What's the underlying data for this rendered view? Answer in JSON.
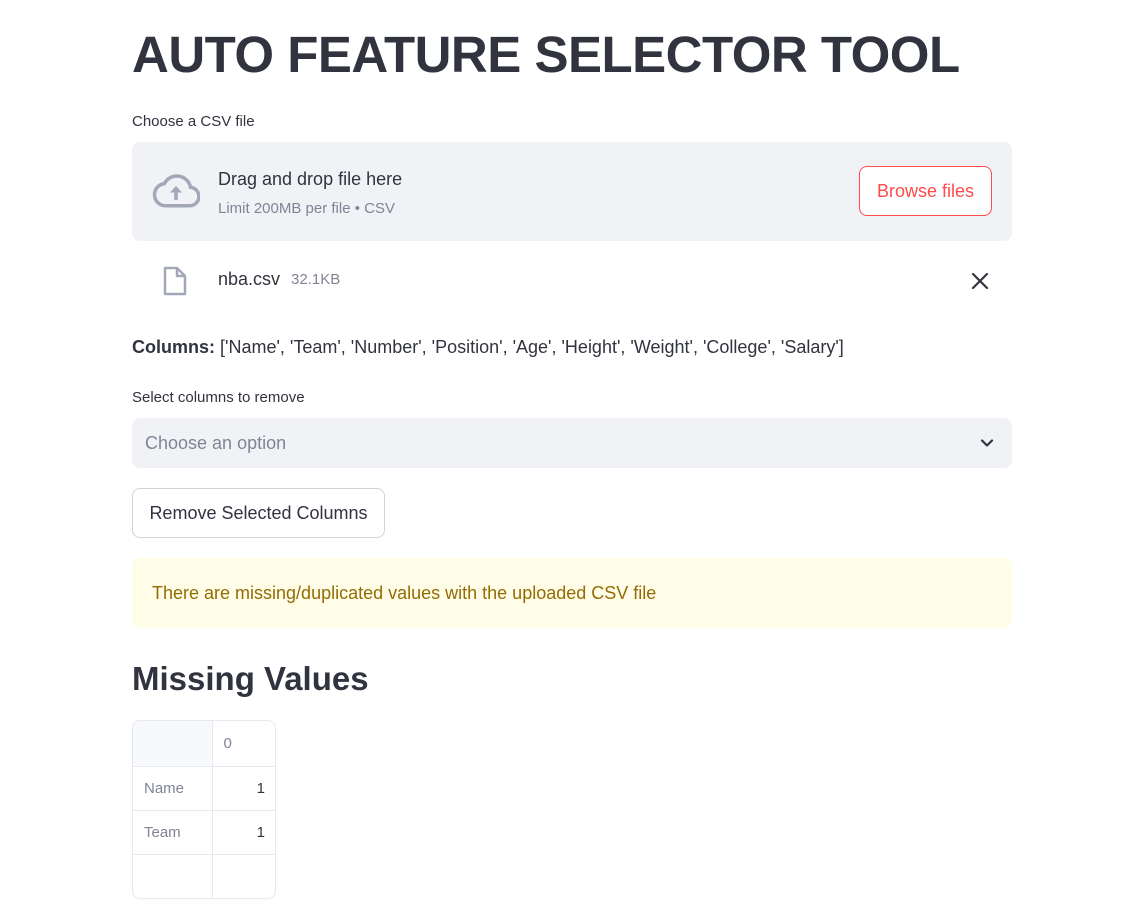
{
  "title": "AUTO FEATURE SELECTOR TOOL",
  "uploader": {
    "label": "Choose a CSV file",
    "drop_title": "Drag and drop file here",
    "limit_text": "Limit 200MB per file • CSV",
    "browse_label": "Browse files",
    "upload_icon": "cloud-upload-icon"
  },
  "uploaded_file": {
    "name": "nba.csv",
    "size": "32.1KB",
    "file_icon": "file-icon",
    "close_icon": "close-icon"
  },
  "columns_info": {
    "label": "Columns:",
    "value": " ['Name', 'Team', 'Number', 'Position', 'Age', 'Height', 'Weight', 'College', 'Salary']"
  },
  "multiselect": {
    "label": "Select columns to remove",
    "placeholder": "Choose an option",
    "dropdown_icon": "chevron-down-icon"
  },
  "remove_button_label": "Remove Selected Columns",
  "warning": {
    "text": "There are missing/duplicated values with the uploaded CSV file",
    "background": "#fffce7",
    "color": "#926c05"
  },
  "missing_values": {
    "heading": "Missing Values",
    "column_header": "0",
    "rows": [
      {
        "index": "Name",
        "value": "1"
      },
      {
        "index": "Team",
        "value": "1"
      }
    ]
  },
  "colors": {
    "accent": "#ff4b4b",
    "text": "#31333f",
    "muted": "#808495",
    "input_bg": "#f0f2f6"
  }
}
